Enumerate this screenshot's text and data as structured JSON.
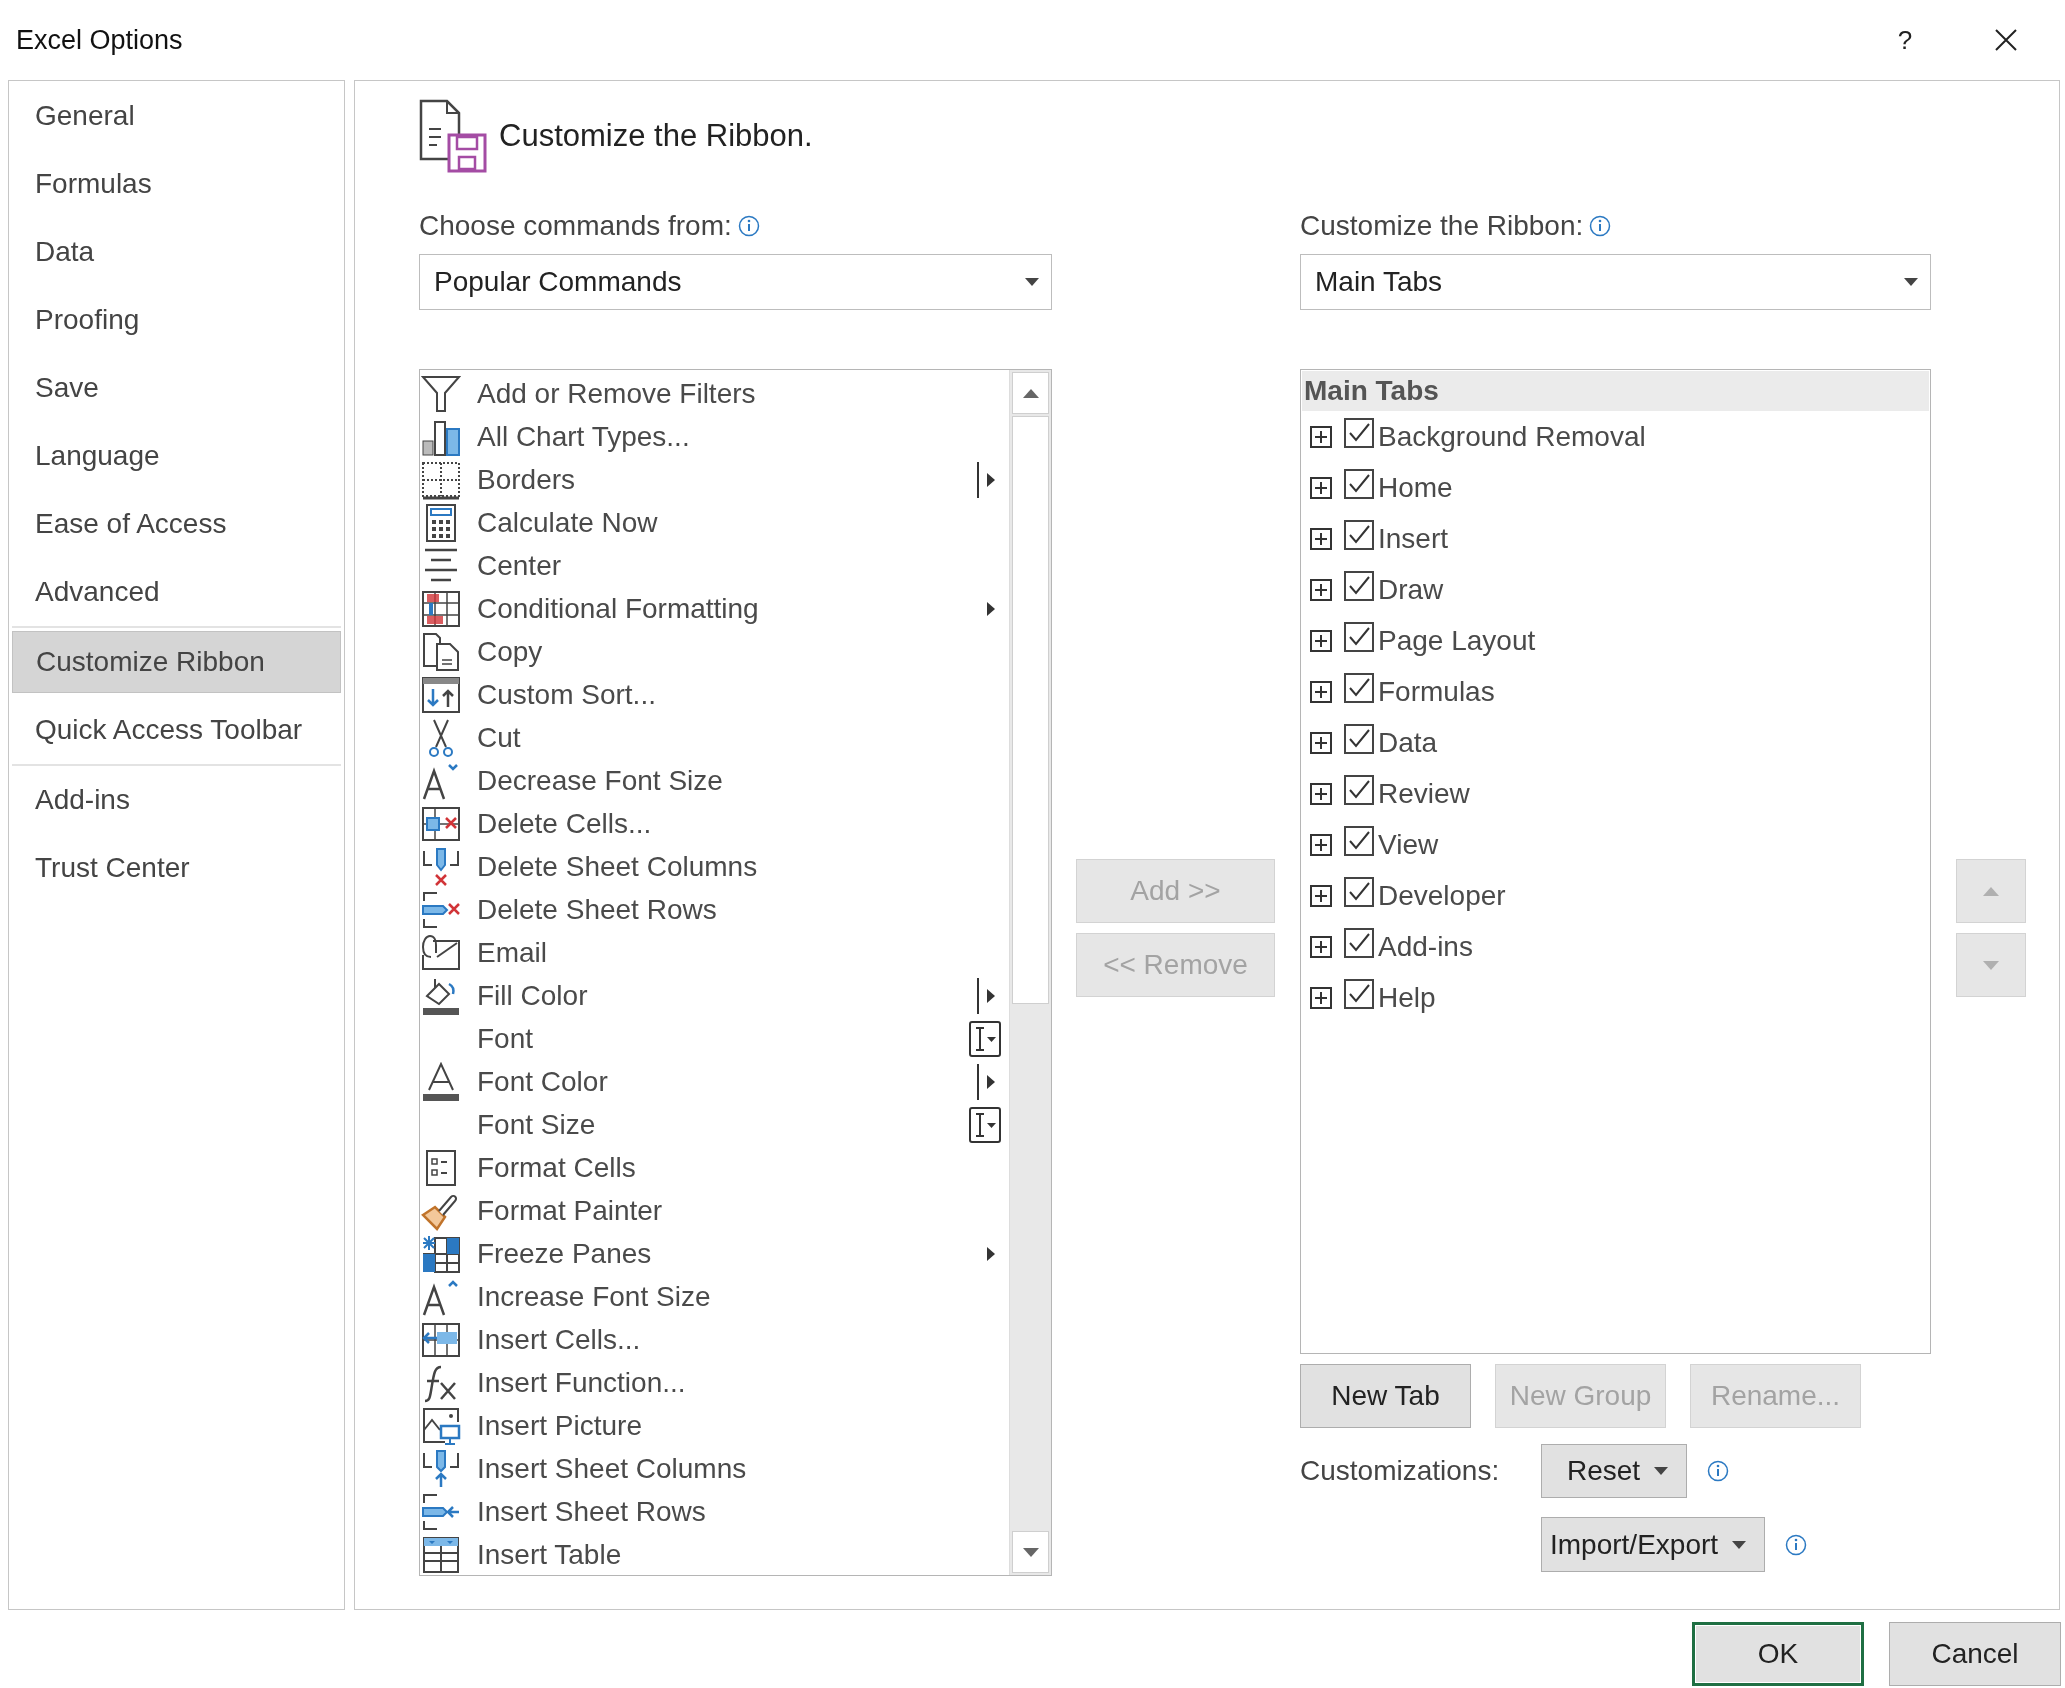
{
  "window": {
    "title": "Excel Options",
    "help": "?"
  },
  "sidebar": {
    "groups": [
      {
        "items": [
          {
            "label": "General",
            "selected": false
          },
          {
            "label": "Formulas",
            "selected": false
          },
          {
            "label": "Data",
            "selected": false
          },
          {
            "label": "Proofing",
            "selected": false
          },
          {
            "label": "Save",
            "selected": false
          },
          {
            "label": "Language",
            "selected": false
          },
          {
            "label": "Ease of Access",
            "selected": false
          },
          {
            "label": "Advanced",
            "selected": false
          }
        ]
      },
      {
        "items": [
          {
            "label": "Customize Ribbon",
            "selected": true
          },
          {
            "label": "Quick Access Toolbar",
            "selected": false
          }
        ]
      },
      {
        "items": [
          {
            "label": "Add-ins",
            "selected": false
          },
          {
            "label": "Trust Center",
            "selected": false
          }
        ]
      }
    ]
  },
  "page": {
    "title": "Customize the Ribbon.",
    "commands": {
      "label": "Choose commands from:",
      "dropdown": "Popular Commands",
      "items": [
        {
          "label": "Add or Remove Filters"
        },
        {
          "label": "All Chart Types..."
        },
        {
          "label": "Borders",
          "kind": "split"
        },
        {
          "label": "Calculate Now"
        },
        {
          "label": "Center"
        },
        {
          "label": "Conditional Formatting",
          "kind": "arrow"
        },
        {
          "label": "Copy"
        },
        {
          "label": "Custom Sort..."
        },
        {
          "label": "Cut"
        },
        {
          "label": "Decrease Font Size"
        },
        {
          "label": "Delete Cells..."
        },
        {
          "label": "Delete Sheet Columns"
        },
        {
          "label": "Delete Sheet Rows"
        },
        {
          "label": "Email"
        },
        {
          "label": "Fill Color",
          "kind": "split"
        },
        {
          "label": "Font",
          "kind": "combo"
        },
        {
          "label": "Font Color",
          "kind": "split"
        },
        {
          "label": "Font Size",
          "kind": "combo"
        },
        {
          "label": "Format Cells"
        },
        {
          "label": "Format Painter"
        },
        {
          "label": "Freeze Panes",
          "kind": "arrow"
        },
        {
          "label": "Increase Font Size"
        },
        {
          "label": "Insert Cells..."
        },
        {
          "label": "Insert Function..."
        },
        {
          "label": "Insert Picture"
        },
        {
          "label": "Insert Sheet Columns"
        },
        {
          "label": "Insert Sheet Rows"
        },
        {
          "label": "Insert Table"
        }
      ]
    },
    "move_buttons": [
      {
        "label": "Add >>",
        "disabled": true
      },
      {
        "label": "<< Remove",
        "disabled": true
      }
    ],
    "ribbon": {
      "label": "Customize the Ribbon:",
      "dropdown": "Main Tabs",
      "tree_header": "Main Tabs",
      "tabs": [
        {
          "label": "Background Removal",
          "checked": true,
          "expanded": false
        },
        {
          "label": "Home",
          "checked": true,
          "expanded": false
        },
        {
          "label": "Insert",
          "checked": true,
          "expanded": false
        },
        {
          "label": "Draw",
          "checked": true,
          "expanded": false
        },
        {
          "label": "Page Layout",
          "checked": true,
          "expanded": false
        },
        {
          "label": "Formulas",
          "checked": true,
          "expanded": false
        },
        {
          "label": "Data",
          "checked": true,
          "expanded": false
        },
        {
          "label": "Review",
          "checked": true,
          "expanded": false
        },
        {
          "label": "View",
          "checked": true,
          "expanded": false
        },
        {
          "label": "Developer",
          "checked": true,
          "expanded": false
        },
        {
          "label": "Add-ins",
          "checked": true,
          "expanded": false
        },
        {
          "label": "Help",
          "checked": true,
          "expanded": false
        }
      ]
    },
    "order_buttons": [
      {
        "kind": "up",
        "disabled": true
      },
      {
        "kind": "down",
        "disabled": true
      }
    ],
    "tab_buttons": [
      {
        "label": "New Tab",
        "disabled": false
      },
      {
        "label": "New Group",
        "disabled": true
      },
      {
        "label": "Rename...",
        "disabled": true
      }
    ],
    "customizations": {
      "label": "Customizations:",
      "reset": "Reset",
      "import_export": "Import/Export"
    }
  },
  "footer": {
    "ok": "OK",
    "cancel": "Cancel"
  }
}
